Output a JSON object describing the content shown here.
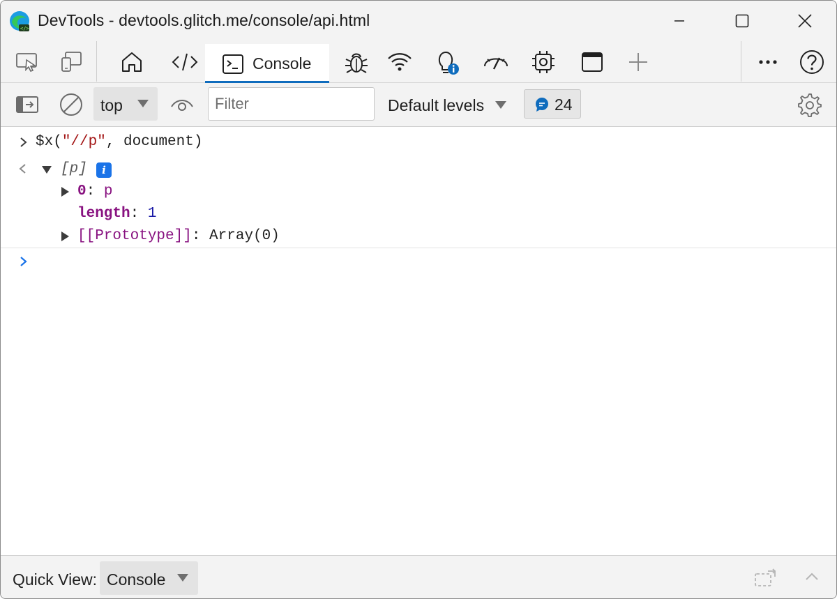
{
  "window": {
    "title": "DevTools - devtools.glitch.me/console/api.html",
    "controls": [
      "minimize",
      "maximize",
      "close"
    ]
  },
  "tabs": {
    "items": [
      {
        "name": "inspect-icon"
      },
      {
        "name": "device-emulation-icon"
      },
      {
        "name": "welcome-home-icon"
      },
      {
        "name": "elements-code-icon"
      },
      {
        "name": "console-tab",
        "label": "Console",
        "active": true
      },
      {
        "name": "sources-bug-icon"
      },
      {
        "name": "network-wifi-icon"
      },
      {
        "name": "issues-bulb-icon"
      },
      {
        "name": "performance-gauge-icon"
      },
      {
        "name": "memory-chip-icon"
      },
      {
        "name": "application-window-icon"
      },
      {
        "name": "add-tool-icon"
      }
    ],
    "more": "more-tools-icon",
    "help": "help-icon"
  },
  "console_toolbar": {
    "context": "top",
    "filter_placeholder": "Filter",
    "filter_value": "",
    "levels": "Default levels",
    "message_count": "24"
  },
  "console": {
    "input_prefix": "$x(",
    "input_string": "\"//p\"",
    "input_suffix": ", document)",
    "result_label": "[p]",
    "info_glyph": "i",
    "row0_key": "0",
    "row0_value": "p",
    "row1_key": "length",
    "row1_value": "1",
    "row2_key": "[[Prototype]]",
    "row2_value": "Array(0)",
    "colon": ": "
  },
  "quick_view": {
    "label": "Quick View:",
    "selected": "Console"
  },
  "colors": {
    "accent": "#0f6cbd",
    "prompt": "#1a73e8",
    "string": "#a31515",
    "key": "#881280",
    "number": "#1a1aa6"
  }
}
